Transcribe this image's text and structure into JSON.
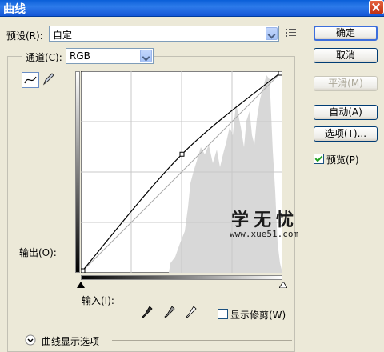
{
  "window": {
    "title": "曲线"
  },
  "preset": {
    "label": "预设(R):",
    "value": "自定"
  },
  "channel": {
    "label": "通道(C):",
    "value": "RGB"
  },
  "buttons": {
    "ok": "确定",
    "cancel": "取消",
    "smooth": "平滑(M)",
    "auto": "自动(A)",
    "options": "选项(T)..."
  },
  "preview": {
    "label": "预览(P)",
    "checked": true
  },
  "axis": {
    "output_label": "输出(O):",
    "input_label": "输入(I):"
  },
  "show_clipping": {
    "label": "显示修剪(W)",
    "checked": false
  },
  "curve_options": {
    "label": "曲线显示选项"
  },
  "watermark": {
    "logo": "学无忧",
    "url": "www.xue51.com"
  },
  "icons": {
    "preset_menu": "preset-options-icon",
    "curve_tool": "curve-point-icon",
    "pencil_tool": "pencil-icon",
    "black_point": "eyedropper-black-icon",
    "gray_point": "eyedropper-gray-icon",
    "white_point": "eyedropper-white-icon"
  },
  "chart_data": {
    "type": "line",
    "xlim": [
      0,
      255
    ],
    "ylim": [
      0,
      255
    ],
    "grid": true,
    "series": [
      {
        "x": [
          0,
          128,
          255
        ],
        "y": [
          0,
          150,
          255
        ]
      }
    ],
    "baseline": {
      "x": [
        0,
        255
      ],
      "y": [
        0,
        255
      ]
    }
  }
}
